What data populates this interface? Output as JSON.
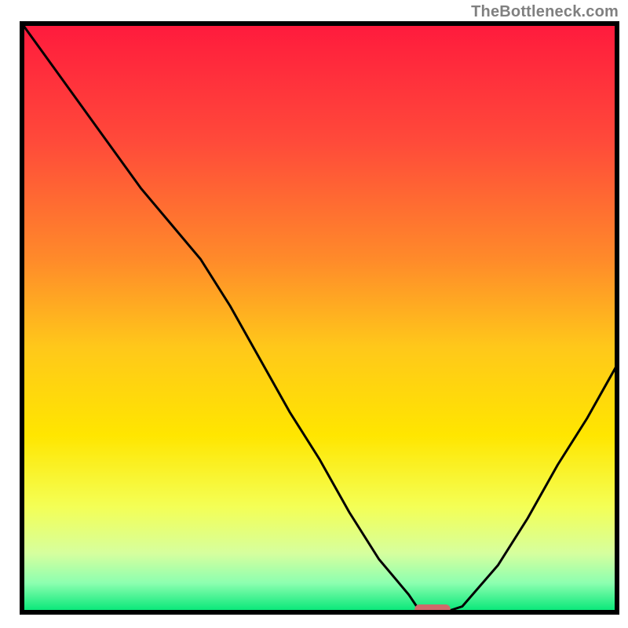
{
  "watermark": "TheBottleneck.com",
  "chart_data": {
    "type": "line",
    "title": "",
    "xlabel": "",
    "ylabel": "",
    "xlim": [
      0,
      100
    ],
    "ylim": [
      0,
      100
    ],
    "x": [
      0,
      5,
      10,
      15,
      20,
      25,
      30,
      35,
      40,
      45,
      50,
      55,
      60,
      65,
      67,
      71,
      74,
      80,
      85,
      90,
      95,
      100
    ],
    "values": [
      100,
      93,
      86,
      79,
      72,
      66,
      60,
      52,
      43,
      34,
      26,
      17,
      9,
      3,
      0,
      0,
      1,
      8,
      16,
      25,
      33,
      42
    ],
    "optimal_marker": {
      "x_center": 69,
      "x_width": 6,
      "y": 0
    },
    "gradient_stops": [
      {
        "offset": 0.0,
        "color": "#ff1a3d"
      },
      {
        "offset": 0.2,
        "color": "#ff4a3a"
      },
      {
        "offset": 0.4,
        "color": "#ff8a2a"
      },
      {
        "offset": 0.55,
        "color": "#ffc81a"
      },
      {
        "offset": 0.7,
        "color": "#ffe600"
      },
      {
        "offset": 0.82,
        "color": "#f4ff55"
      },
      {
        "offset": 0.9,
        "color": "#d6ff9e"
      },
      {
        "offset": 0.95,
        "color": "#8dffb0"
      },
      {
        "offset": 1.0,
        "color": "#00e676"
      }
    ],
    "frame": {
      "stroke": "#000000",
      "stroke_width": 6
    }
  }
}
